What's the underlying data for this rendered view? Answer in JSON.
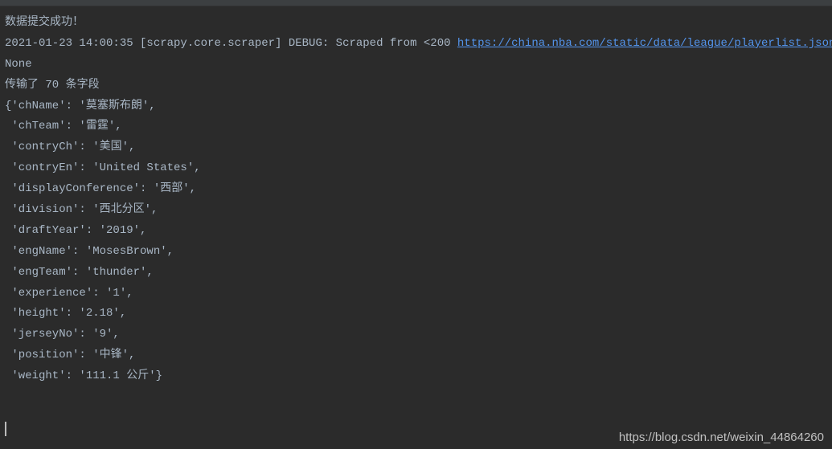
{
  "console": {
    "success_msg": "数据提交成功！",
    "log_line_prefix": "2021-01-23 14:00:35 [scrapy.core.scraper] DEBUG: Scraped from <200 ",
    "log_line_url": "https://china.nba.com/static/data/league/playerlist.json",
    "log_line_suffix": ">",
    "none_line": "None",
    "transmit_line": "传输了 70 条字段",
    "dict_open": "{'chName': '莫塞斯布朗',",
    "fields": [
      " 'chTeam': '雷霆',",
      " 'contryCh': '美国',",
      " 'contryEn': 'United States',",
      " 'displayConference': '西部',",
      " 'division': '西北分区',",
      " 'draftYear': '2019',",
      " 'engName': 'MosesBrown',",
      " 'engTeam': 'thunder',",
      " 'experience': '1',",
      " 'height': '2.18',",
      " 'jerseyNo': '9',",
      " 'position': '中锋',",
      " 'weight': '111.1 公斤'}"
    ]
  },
  "watermark": "https://blog.csdn.net/weixin_44864260"
}
